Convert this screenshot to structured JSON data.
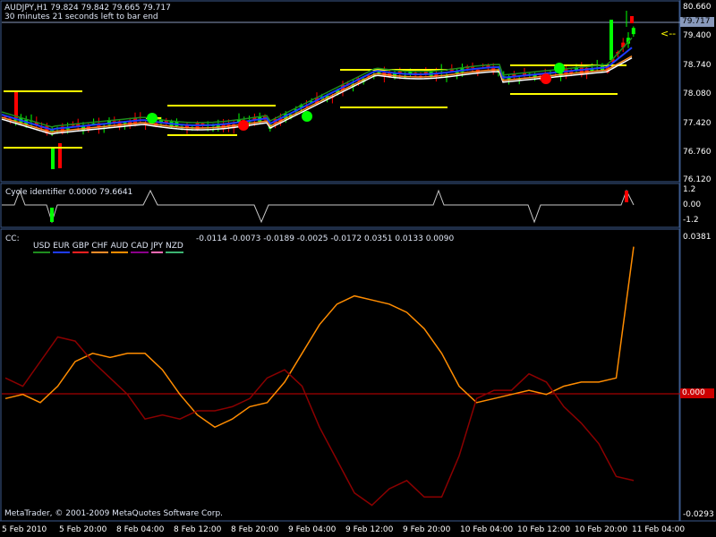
{
  "header": {
    "symbol_line": "AUDJPY,H1  79.824 79.842 79.665 79.717",
    "timer": "30 minutes 21 seconds left to bar end"
  },
  "price_panel": {
    "y_labels": [
      "80.660",
      "79.400",
      "78.740",
      "78.080",
      "77.420",
      "76.760",
      "76.120"
    ],
    "current_price": "79.717",
    "arrow_label": "<--"
  },
  "cycle_panel": {
    "title": "Cycle identifier 0.0000 79.6641",
    "y_labels": [
      "1.2",
      "0.00",
      "-1.2"
    ]
  },
  "cc_panel": {
    "prefix": "CC:",
    "legend": [
      "USD",
      "EUR",
      "GBP",
      "CHF",
      "AUD",
      "CAD",
      "JPY",
      "NZD"
    ],
    "values": "-0.0114 -0.0073 -0.0189 -0.0025 -0.0172 0.0351 0.0133 0.0090",
    "y_labels": [
      "0.0381",
      "0.000",
      "-0.0293"
    ],
    "zero_box": "0.000"
  },
  "footer": {
    "copyright": "MetaTrader, © 2001-2009 MetaQuotes Software Corp."
  },
  "x_axis": [
    "5 Feb 2010",
    "5 Feb 20:00",
    "8 Feb 04:00",
    "8 Feb 12:00",
    "8 Feb 20:00",
    "9 Feb 04:00",
    "9 Feb 12:00",
    "9 Feb 20:00",
    "10 Feb 04:00",
    "10 Feb 12:00",
    "10 Feb 20:00",
    "11 Feb 04:00"
  ],
  "colors": {
    "bull": "#00ff00",
    "bear": "#ff0000",
    "frame": "#3c5a8c",
    "sr": "#ffff00",
    "ma_fast": "#1e8c1e",
    "ma_mid": "#1e3cff",
    "ma_slow": "#ff8c28",
    "ma_white": "#ffffff",
    "aud": "#ff8c00",
    "other": "#8b0000"
  },
  "chart_data": [
    {
      "type": "line",
      "title": "",
      "series": [
        {
          "name": "AUD",
          "values": [
            -0.001,
            0.0,
            -0.002,
            0.002,
            0.008,
            0.01,
            0.009,
            0.01,
            0.01,
            0.006,
            0.0,
            -0.005,
            -0.008,
            -0.006,
            -0.003,
            -0.002,
            0.003,
            0.01,
            0.017,
            0.022,
            0.024,
            0.023,
            0.022,
            0.02,
            0.016,
            0.01,
            0.002,
            -0.002,
            -0.001,
            0.0,
            0.001,
            0.0,
            0.002,
            0.003,
            0.003,
            0.004,
            0.036
          ]
        },
        {
          "name": "",
          "values": [
            0.004,
            0.002,
            0.008,
            0.014,
            0.013,
            0.008,
            0.004,
            0.0,
            -0.006,
            -0.005,
            -0.006,
            -0.004,
            -0.004,
            -0.003,
            -0.001,
            0.004,
            0.006,
            0.002,
            -0.008,
            -0.016,
            -0.024,
            -0.027,
            -0.023,
            -0.021,
            -0.025,
            -0.025,
            -0.015,
            -0.001,
            0.001,
            0.001,
            0.005,
            0.003,
            -0.003,
            -0.007,
            -0.012,
            -0.02,
            -0.021
          ]
        }
      ],
      "ylim": [
        -0.0293,
        0.0381
      ]
    }
  ]
}
